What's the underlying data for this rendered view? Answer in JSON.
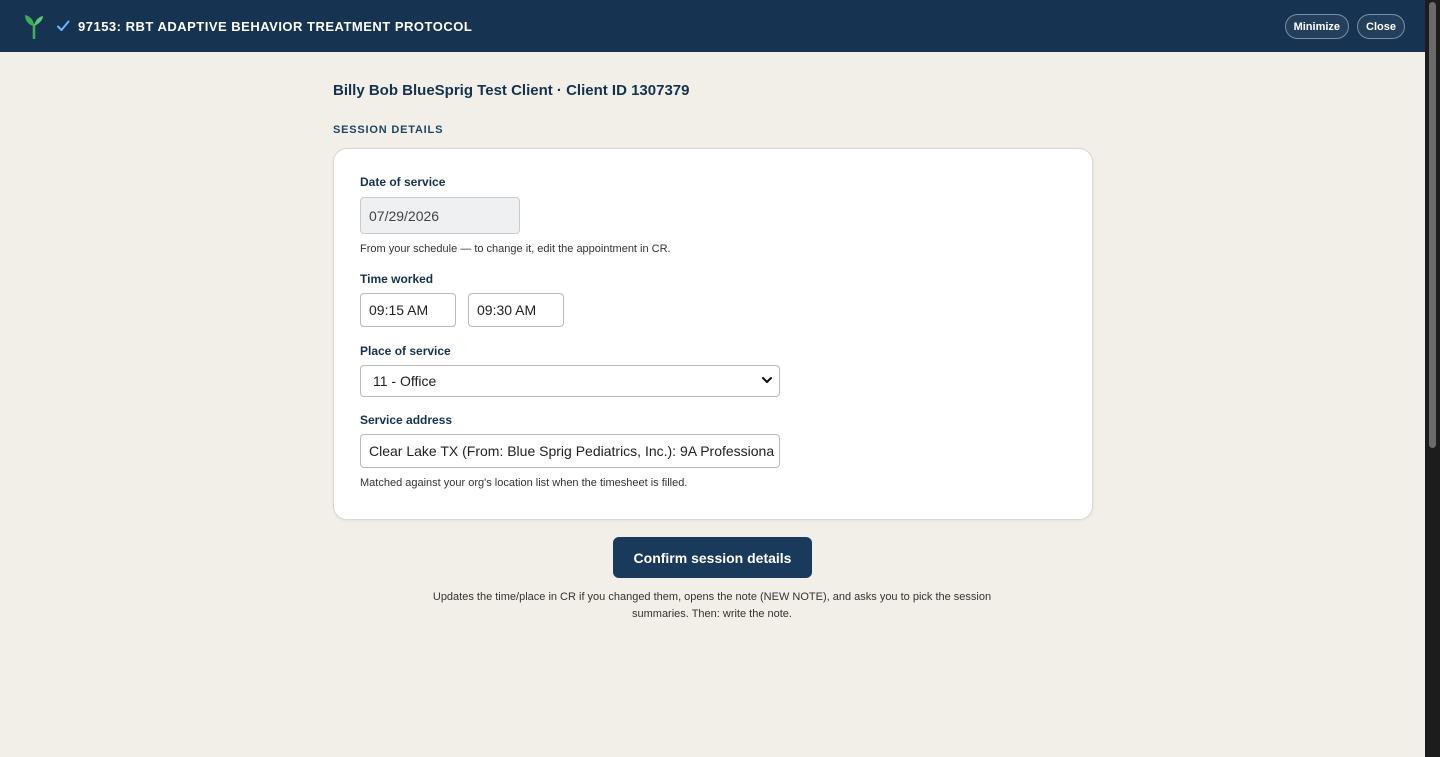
{
  "window": {
    "title": "97153: RBT ADAPTIVE BEHAVIOR TREATMENT PROTOCOL",
    "minimize_label": "Minimize",
    "close_label": "Close",
    "logo_icon": "sprout-icon",
    "status_icon": "checkmark-icon"
  },
  "client": {
    "header": "Billy Bob BlueSprig Test Client · Client ID 1307379"
  },
  "session_details": {
    "section_label": "SESSION DETAILS",
    "date_of_service": {
      "label": "Date of service",
      "value": "07/29/2026",
      "hint": "From your schedule — to change it, edit the appointment in CR."
    },
    "time_worked": {
      "label": "Time worked",
      "start": "09:15 AM",
      "end": "09:30 AM"
    },
    "place_of_service": {
      "label": "Place of service",
      "selected": "11 - Office"
    },
    "service_address": {
      "label": "Service address",
      "value": "Clear Lake TX (From: Blue Sprig Pediatrics, Inc.): 9A Professiona",
      "hint": "Matched against your org's location list when the timesheet is filled."
    }
  },
  "actions": {
    "confirm_label": "Confirm session details",
    "footnote": "Updates the time/place in CR if you changed them, opens the note (NEW NOTE), and asks you to pick the session summaries. Then: write the note."
  },
  "colors": {
    "topbar": "#163452",
    "accent_green": "#3fae5a",
    "button": "#1a3a5c",
    "background": "#f2efe8"
  }
}
